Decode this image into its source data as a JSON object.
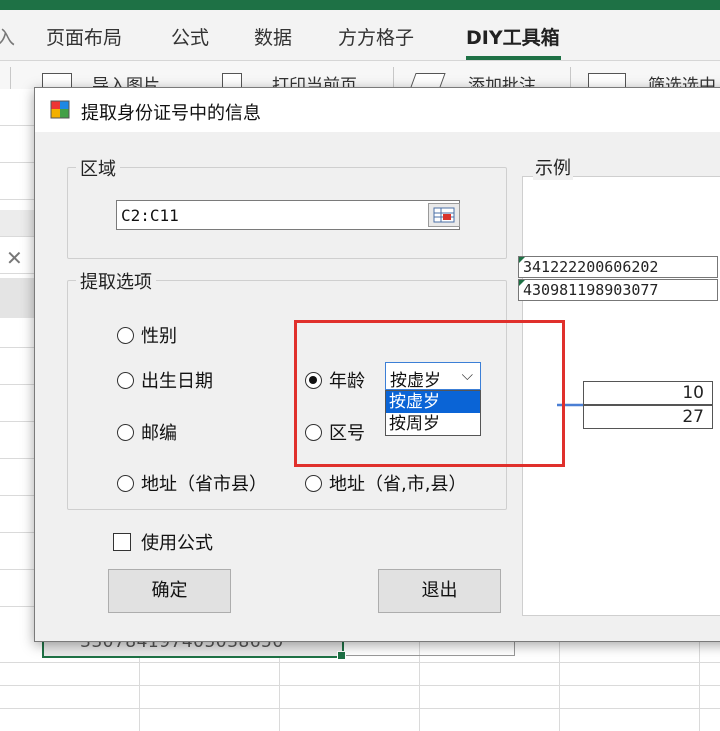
{
  "ribbon": {
    "tabs": [
      "页面布局",
      "公式",
      "数据",
      "方方格子",
      "DIY工具箱"
    ],
    "active_tab": "DIY工具箱",
    "tools": [
      "导入图片",
      "打印当前页",
      "添加批注",
      "筛选选中"
    ],
    "accent_color": "#1e7145"
  },
  "sheet": {
    "selected_cell_value": "330784197405038650"
  },
  "dialog": {
    "title": "提取身份证号中的信息",
    "title_icon": "app-window-icon",
    "range_group_label": "区域",
    "range_value": "C2:C11",
    "range_picker_icon": "range-select-icon",
    "options_group_label": "提取选项",
    "options": {
      "gender": "性别",
      "birthdate": "出生日期",
      "postcode": "邮编",
      "address_county": "地址（省市县）",
      "age": "年龄",
      "district_code": "区号",
      "address_separated": "地址（省,市,县）"
    },
    "selected_option": "年龄",
    "age_combo": {
      "value": "按虚岁",
      "options": [
        "按虚岁",
        "按周岁"
      ],
      "highlighted": "按虚岁"
    },
    "use_formula_label": "使用公式",
    "use_formula_checked": false,
    "ok_label": "确定",
    "exit_label": "退出",
    "example": {
      "label": "示例",
      "id_numbers": [
        "341222200606202",
        "430981198903077"
      ],
      "results": [
        "10",
        "27"
      ],
      "arrow_icon": "arrow-right-icon"
    },
    "highlight_color": "#e0302c"
  }
}
